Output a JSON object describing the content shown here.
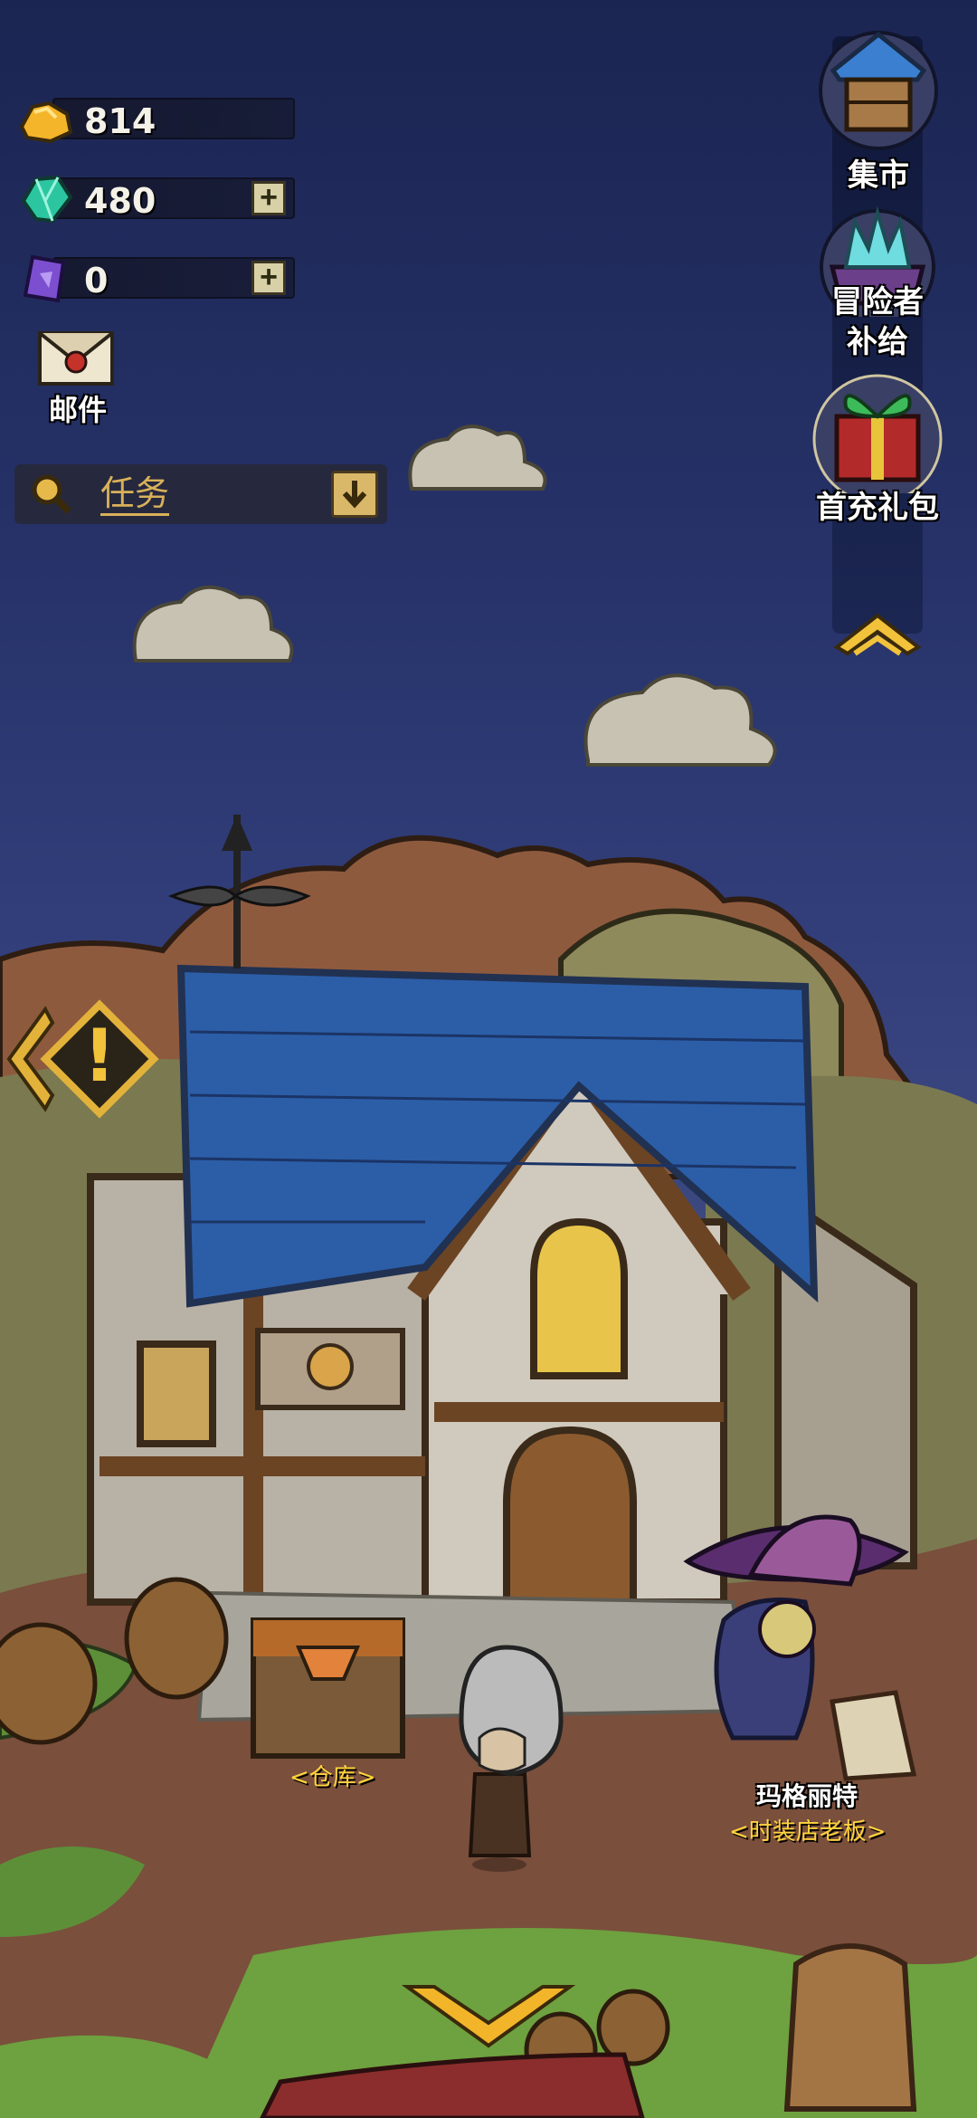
{
  "resources": {
    "gold": "814",
    "gems": "480",
    "cards": "0",
    "plus": "+"
  },
  "mail": {
    "label": "邮件"
  },
  "quest": {
    "title": "任务"
  },
  "right_menu": {
    "market": "集市",
    "adventurer_line1": "冒险者",
    "adventurer_line2": "补给",
    "first_recharge": "首充礼包"
  },
  "left_alert": {
    "symbol": "!"
  },
  "scene": {
    "warehouse_label": "<仓库>",
    "npc_name": "玛格丽特",
    "npc_title": "<时装店老板>"
  },
  "icons": {
    "gold": "gold-nugget-icon",
    "gems": "gem-crystal-icon",
    "cards": "purple-card-icon",
    "search": "search-icon",
    "dropdown": "down-arrow-icon",
    "collapse": "chevron-up-icon",
    "bottom": "chevron-down-icon"
  }
}
